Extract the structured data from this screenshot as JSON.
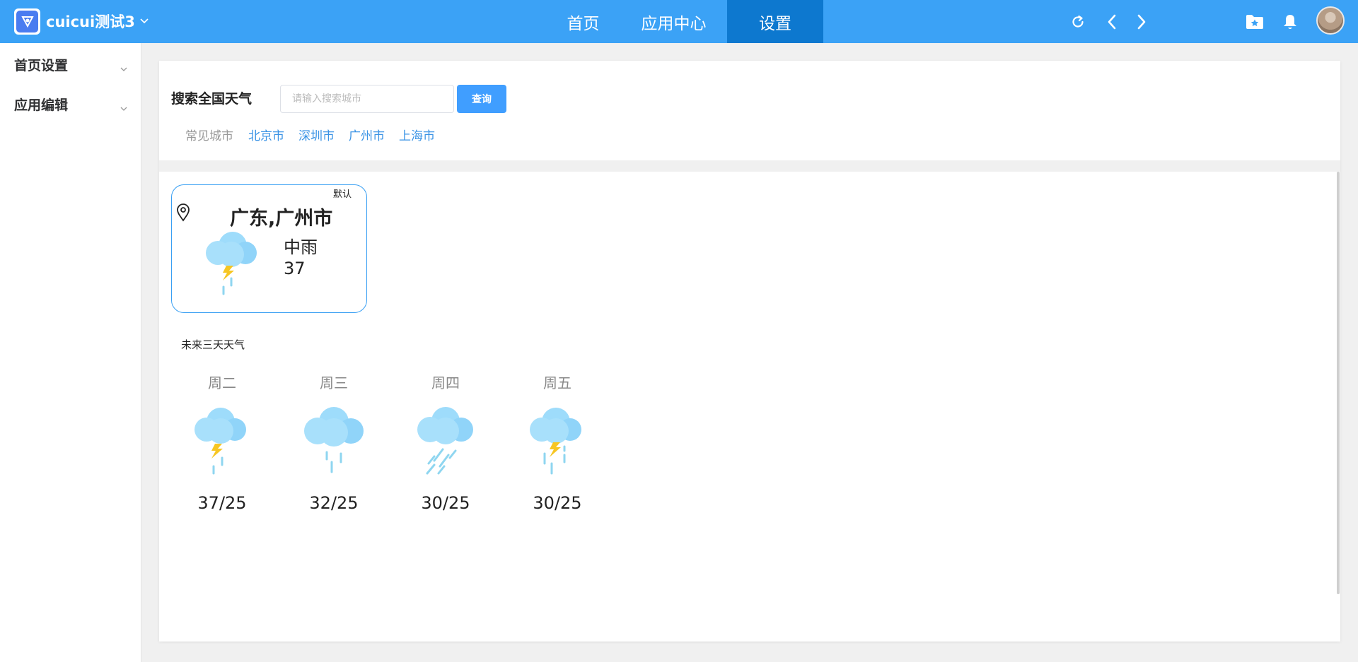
{
  "header": {
    "app_title": "cuicui测试3",
    "nav": [
      {
        "label": "首页",
        "active": false
      },
      {
        "label": "应用中心",
        "active": false
      },
      {
        "label": "设置",
        "active": true
      }
    ],
    "icons": [
      "refresh-icon",
      "back-icon",
      "forward-icon",
      "starred-folder-icon",
      "bell-icon",
      "avatar"
    ]
  },
  "sidebar": {
    "items": [
      {
        "label": "首页设置"
      },
      {
        "label": "应用编辑"
      }
    ]
  },
  "search": {
    "label": "搜索全国天气",
    "placeholder": "请输入搜索城市",
    "value": "",
    "button_label": "查询"
  },
  "common_cities": {
    "label": "常见城市",
    "cities": [
      "北京市",
      "深圳市",
      "广州市",
      "上海市"
    ]
  },
  "current": {
    "tag": "默认",
    "city": "广东,广州市",
    "condition": "中雨",
    "temperature": "37",
    "icon": "thunderstorm-rain-icon"
  },
  "forecast": {
    "title": "未来三天天气",
    "days": [
      {
        "day": "周二",
        "temp": "37/25",
        "icon": "thunderstorm-rain-icon"
      },
      {
        "day": "周三",
        "temp": "32/25",
        "icon": "rain-icon"
      },
      {
        "day": "周四",
        "temp": "30/25",
        "icon": "heavy-rain-icon"
      },
      {
        "day": "周五",
        "temp": "30/25",
        "icon": "thunderstorm-rain-icon"
      }
    ]
  },
  "colors": {
    "header_bg": "#3ba2f6",
    "nav_active_bg": "#0d78cf",
    "primary": "#409eff",
    "link": "#3a93e5",
    "card_border": "#3aa0f3",
    "cloud": "#a8e0fb",
    "lightning": "#f6c623"
  }
}
